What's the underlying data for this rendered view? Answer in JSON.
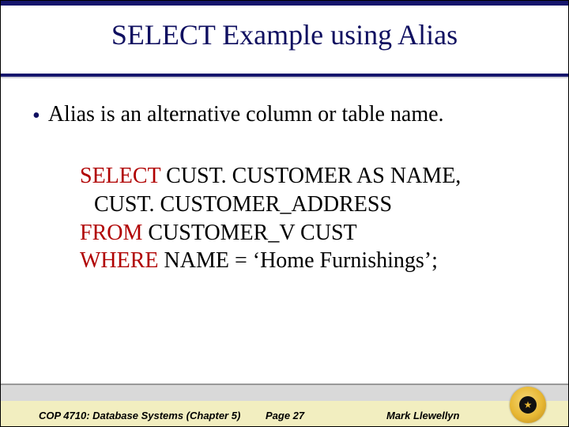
{
  "title": "SELECT Example using Alias",
  "bullet": "Alias is an alternative column or table name.",
  "sql": {
    "line1": {
      "kw": "SELECT",
      "rest": " CUST. CUSTOMER AS NAME,"
    },
    "line2": "CUST. CUSTOMER_ADDRESS",
    "line3": {
      "kw": "FROM",
      "rest": " CUSTOMER_V CUST"
    },
    "line4": {
      "kw": "WHERE",
      "rest": " NAME = ‘Home Furnishings’;"
    }
  },
  "footer": {
    "left": "COP 4710: Database Systems  (Chapter 5)",
    "mid": "Page 27",
    "right": "Mark Llewellyn"
  }
}
